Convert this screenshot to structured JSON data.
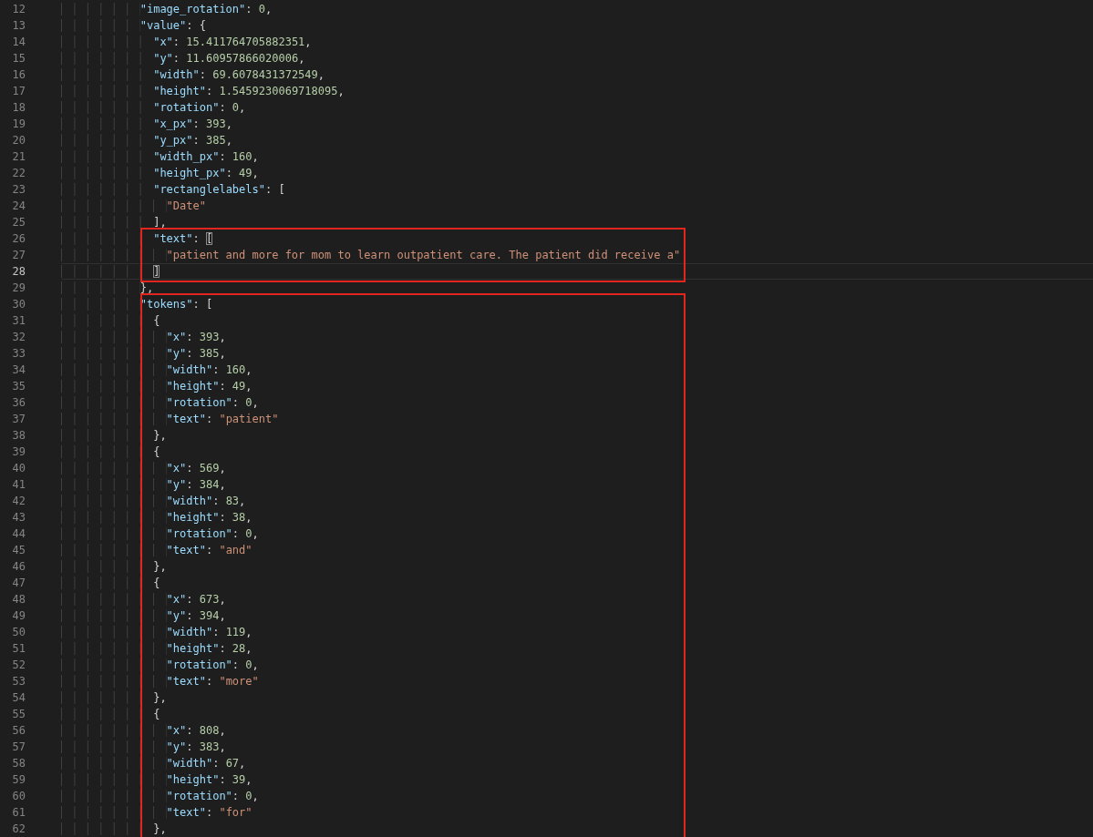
{
  "editor": {
    "blocks": [
      {
        "boxed": false,
        "lines": [
          {
            "number": "12",
            "current": false,
            "parts": [
              {
                "kind": "key",
                "text": "            \"image_rotation\""
              },
              {
                "kind": "punct",
                "text": ": "
              },
              {
                "kind": "number",
                "text": "0"
              },
              {
                "kind": "punct",
                "text": ","
              }
            ]
          },
          {
            "number": "13",
            "current": false,
            "parts": [
              {
                "kind": "key",
                "text": "            \"value\""
              },
              {
                "kind": "punct",
                "text": ": {"
              }
            ]
          },
          {
            "number": "14",
            "current": false,
            "parts": [
              {
                "kind": "key",
                "text": "              \"x\""
              },
              {
                "kind": "punct",
                "text": ": "
              },
              {
                "kind": "number",
                "text": "15.411764705882351"
              },
              {
                "kind": "punct",
                "text": ","
              }
            ]
          },
          {
            "number": "15",
            "current": false,
            "parts": [
              {
                "kind": "key",
                "text": "              \"y\""
              },
              {
                "kind": "punct",
                "text": ": "
              },
              {
                "kind": "number",
                "text": "11.60957866020006"
              },
              {
                "kind": "punct",
                "text": ","
              }
            ]
          },
          {
            "number": "16",
            "current": false,
            "parts": [
              {
                "kind": "key",
                "text": "              \"width\""
              },
              {
                "kind": "punct",
                "text": ": "
              },
              {
                "kind": "number",
                "text": "69.6078431372549"
              },
              {
                "kind": "punct",
                "text": ","
              }
            ]
          },
          {
            "number": "17",
            "current": false,
            "parts": [
              {
                "kind": "key",
                "text": "              \"height\""
              },
              {
                "kind": "punct",
                "text": ": "
              },
              {
                "kind": "number",
                "text": "1.5459230069718095"
              },
              {
                "kind": "punct",
                "text": ","
              }
            ]
          },
          {
            "number": "18",
            "current": false,
            "parts": [
              {
                "kind": "key",
                "text": "              \"rotation\""
              },
              {
                "kind": "punct",
                "text": ": "
              },
              {
                "kind": "number",
                "text": "0"
              },
              {
                "kind": "punct",
                "text": ","
              }
            ]
          },
          {
            "number": "19",
            "current": false,
            "parts": [
              {
                "kind": "key",
                "text": "              \"x_px\""
              },
              {
                "kind": "punct",
                "text": ": "
              },
              {
                "kind": "number",
                "text": "393"
              },
              {
                "kind": "punct",
                "text": ","
              }
            ]
          },
          {
            "number": "20",
            "current": false,
            "parts": [
              {
                "kind": "key",
                "text": "              \"y_px\""
              },
              {
                "kind": "punct",
                "text": ": "
              },
              {
                "kind": "number",
                "text": "385"
              },
              {
                "kind": "punct",
                "text": ","
              }
            ]
          },
          {
            "number": "21",
            "current": false,
            "parts": [
              {
                "kind": "key",
                "text": "              \"width_px\""
              },
              {
                "kind": "punct",
                "text": ": "
              },
              {
                "kind": "number",
                "text": "160"
              },
              {
                "kind": "punct",
                "text": ","
              }
            ]
          },
          {
            "number": "22",
            "current": false,
            "parts": [
              {
                "kind": "key",
                "text": "              \"height_px\""
              },
              {
                "kind": "punct",
                "text": ": "
              },
              {
                "kind": "number",
                "text": "49"
              },
              {
                "kind": "punct",
                "text": ","
              }
            ]
          },
          {
            "number": "23",
            "current": false,
            "parts": [
              {
                "kind": "key",
                "text": "              \"rectanglelabels\""
              },
              {
                "kind": "punct",
                "text": ": ["
              }
            ]
          },
          {
            "number": "24",
            "current": false,
            "parts": [
              {
                "kind": "string",
                "text": "                \"Date\""
              }
            ]
          },
          {
            "number": "25",
            "current": false,
            "parts": [
              {
                "kind": "punct",
                "text": "              ],"
              }
            ]
          }
        ]
      },
      {
        "boxed": true,
        "lines": [
          {
            "number": "26",
            "current": false,
            "parts": [
              {
                "kind": "key",
                "text": "              \"text\""
              },
              {
                "kind": "punct",
                "text": ": "
              },
              {
                "kind": "bracket",
                "text": "["
              }
            ]
          },
          {
            "number": "27",
            "current": false,
            "parts": [
              {
                "kind": "string",
                "text": "                \"patient and more for mom to learn outpatient care. The patient did receive a\""
              }
            ]
          },
          {
            "number": "28",
            "current": true,
            "parts": [
              {
                "kind": "bracket",
                "text": "              ]"
              }
            ]
          }
        ]
      },
      {
        "boxed": false,
        "lines": [
          {
            "number": "29",
            "current": false,
            "parts": [
              {
                "kind": "punct",
                "text": "            },"
              }
            ]
          }
        ]
      },
      {
        "boxed": true,
        "lines": [
          {
            "number": "30",
            "current": false,
            "parts": [
              {
                "kind": "key",
                "text": "            \"tokens\""
              },
              {
                "kind": "punct",
                "text": ": ["
              }
            ]
          },
          {
            "number": "31",
            "current": false,
            "parts": [
              {
                "kind": "punct",
                "text": "              {"
              }
            ]
          },
          {
            "number": "32",
            "current": false,
            "parts": [
              {
                "kind": "key",
                "text": "                \"x\""
              },
              {
                "kind": "punct",
                "text": ": "
              },
              {
                "kind": "number",
                "text": "393"
              },
              {
                "kind": "punct",
                "text": ","
              }
            ]
          },
          {
            "number": "33",
            "current": false,
            "parts": [
              {
                "kind": "key",
                "text": "                \"y\""
              },
              {
                "kind": "punct",
                "text": ": "
              },
              {
                "kind": "number",
                "text": "385"
              },
              {
                "kind": "punct",
                "text": ","
              }
            ]
          },
          {
            "number": "34",
            "current": false,
            "parts": [
              {
                "kind": "key",
                "text": "                \"width\""
              },
              {
                "kind": "punct",
                "text": ": "
              },
              {
                "kind": "number",
                "text": "160"
              },
              {
                "kind": "punct",
                "text": ","
              }
            ]
          },
          {
            "number": "35",
            "current": false,
            "parts": [
              {
                "kind": "key",
                "text": "                \"height\""
              },
              {
                "kind": "punct",
                "text": ": "
              },
              {
                "kind": "number",
                "text": "49"
              },
              {
                "kind": "punct",
                "text": ","
              }
            ]
          },
          {
            "number": "36",
            "current": false,
            "parts": [
              {
                "kind": "key",
                "text": "                \"rotation\""
              },
              {
                "kind": "punct",
                "text": ": "
              },
              {
                "kind": "number",
                "text": "0"
              },
              {
                "kind": "punct",
                "text": ","
              }
            ]
          },
          {
            "number": "37",
            "current": false,
            "parts": [
              {
                "kind": "key",
                "text": "                \"text\""
              },
              {
                "kind": "punct",
                "text": ": "
              },
              {
                "kind": "string",
                "text": "\"patient\""
              }
            ]
          },
          {
            "number": "38",
            "current": false,
            "parts": [
              {
                "kind": "punct",
                "text": "              },"
              }
            ]
          },
          {
            "number": "39",
            "current": false,
            "parts": [
              {
                "kind": "punct",
                "text": "              {"
              }
            ]
          },
          {
            "number": "40",
            "current": false,
            "parts": [
              {
                "kind": "key",
                "text": "                \"x\""
              },
              {
                "kind": "punct",
                "text": ": "
              },
              {
                "kind": "number",
                "text": "569"
              },
              {
                "kind": "punct",
                "text": ","
              }
            ]
          },
          {
            "number": "41",
            "current": false,
            "parts": [
              {
                "kind": "key",
                "text": "                \"y\""
              },
              {
                "kind": "punct",
                "text": ": "
              },
              {
                "kind": "number",
                "text": "384"
              },
              {
                "kind": "punct",
                "text": ","
              }
            ]
          },
          {
            "number": "42",
            "current": false,
            "parts": [
              {
                "kind": "key",
                "text": "                \"width\""
              },
              {
                "kind": "punct",
                "text": ": "
              },
              {
                "kind": "number",
                "text": "83"
              },
              {
                "kind": "punct",
                "text": ","
              }
            ]
          },
          {
            "number": "43",
            "current": false,
            "parts": [
              {
                "kind": "key",
                "text": "                \"height\""
              },
              {
                "kind": "punct",
                "text": ": "
              },
              {
                "kind": "number",
                "text": "38"
              },
              {
                "kind": "punct",
                "text": ","
              }
            ]
          },
          {
            "number": "44",
            "current": false,
            "parts": [
              {
                "kind": "key",
                "text": "                \"rotation\""
              },
              {
                "kind": "punct",
                "text": ": "
              },
              {
                "kind": "number",
                "text": "0"
              },
              {
                "kind": "punct",
                "text": ","
              }
            ]
          },
          {
            "number": "45",
            "current": false,
            "parts": [
              {
                "kind": "key",
                "text": "                \"text\""
              },
              {
                "kind": "punct",
                "text": ": "
              },
              {
                "kind": "string",
                "text": "\"and\""
              }
            ]
          },
          {
            "number": "46",
            "current": false,
            "parts": [
              {
                "kind": "punct",
                "text": "              },"
              }
            ]
          },
          {
            "number": "47",
            "current": false,
            "parts": [
              {
                "kind": "punct",
                "text": "              {"
              }
            ]
          },
          {
            "number": "48",
            "current": false,
            "parts": [
              {
                "kind": "key",
                "text": "                \"x\""
              },
              {
                "kind": "punct",
                "text": ": "
              },
              {
                "kind": "number",
                "text": "673"
              },
              {
                "kind": "punct",
                "text": ","
              }
            ]
          },
          {
            "number": "49",
            "current": false,
            "parts": [
              {
                "kind": "key",
                "text": "                \"y\""
              },
              {
                "kind": "punct",
                "text": ": "
              },
              {
                "kind": "number",
                "text": "394"
              },
              {
                "kind": "punct",
                "text": ","
              }
            ]
          },
          {
            "number": "50",
            "current": false,
            "parts": [
              {
                "kind": "key",
                "text": "                \"width\""
              },
              {
                "kind": "punct",
                "text": ": "
              },
              {
                "kind": "number",
                "text": "119"
              },
              {
                "kind": "punct",
                "text": ","
              }
            ]
          },
          {
            "number": "51",
            "current": false,
            "parts": [
              {
                "kind": "key",
                "text": "                \"height\""
              },
              {
                "kind": "punct",
                "text": ": "
              },
              {
                "kind": "number",
                "text": "28"
              },
              {
                "kind": "punct",
                "text": ","
              }
            ]
          },
          {
            "number": "52",
            "current": false,
            "parts": [
              {
                "kind": "key",
                "text": "                \"rotation\""
              },
              {
                "kind": "punct",
                "text": ": "
              },
              {
                "kind": "number",
                "text": "0"
              },
              {
                "kind": "punct",
                "text": ","
              }
            ]
          },
          {
            "number": "53",
            "current": false,
            "parts": [
              {
                "kind": "key",
                "text": "                \"text\""
              },
              {
                "kind": "punct",
                "text": ": "
              },
              {
                "kind": "string",
                "text": "\"more\""
              }
            ]
          },
          {
            "number": "54",
            "current": false,
            "parts": [
              {
                "kind": "punct",
                "text": "              },"
              }
            ]
          },
          {
            "number": "55",
            "current": false,
            "parts": [
              {
                "kind": "punct",
                "text": "              {"
              }
            ]
          },
          {
            "number": "56",
            "current": false,
            "parts": [
              {
                "kind": "key",
                "text": "                \"x\""
              },
              {
                "kind": "punct",
                "text": ": "
              },
              {
                "kind": "number",
                "text": "808"
              },
              {
                "kind": "punct",
                "text": ","
              }
            ]
          },
          {
            "number": "57",
            "current": false,
            "parts": [
              {
                "kind": "key",
                "text": "                \"y\""
              },
              {
                "kind": "punct",
                "text": ": "
              },
              {
                "kind": "number",
                "text": "383"
              },
              {
                "kind": "punct",
                "text": ","
              }
            ]
          },
          {
            "number": "58",
            "current": false,
            "parts": [
              {
                "kind": "key",
                "text": "                \"width\""
              },
              {
                "kind": "punct",
                "text": ": "
              },
              {
                "kind": "number",
                "text": "67"
              },
              {
                "kind": "punct",
                "text": ","
              }
            ]
          },
          {
            "number": "59",
            "current": false,
            "parts": [
              {
                "kind": "key",
                "text": "                \"height\""
              },
              {
                "kind": "punct",
                "text": ": "
              },
              {
                "kind": "number",
                "text": "39"
              },
              {
                "kind": "punct",
                "text": ","
              }
            ]
          },
          {
            "number": "60",
            "current": false,
            "parts": [
              {
                "kind": "key",
                "text": "                \"rotation\""
              },
              {
                "kind": "punct",
                "text": ": "
              },
              {
                "kind": "number",
                "text": "0"
              },
              {
                "kind": "punct",
                "text": ","
              }
            ]
          },
          {
            "number": "61",
            "current": false,
            "parts": [
              {
                "kind": "key",
                "text": "                \"text\""
              },
              {
                "kind": "punct",
                "text": ": "
              },
              {
                "kind": "string",
                "text": "\"for\""
              }
            ]
          },
          {
            "number": "62",
            "current": false,
            "parts": [
              {
                "kind": "punct",
                "text": "              },"
              }
            ]
          }
        ]
      }
    ]
  }
}
